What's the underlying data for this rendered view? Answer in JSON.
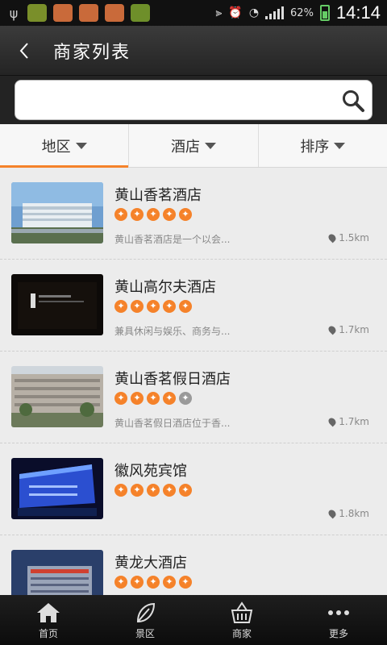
{
  "status_bar": {
    "battery": "62%",
    "time": "14:14"
  },
  "header": {
    "back_icon": "chevron-left-icon",
    "title": "商家列表"
  },
  "search": {
    "value": "",
    "placeholder": ""
  },
  "filters": [
    {
      "label": "地区",
      "active": true
    },
    {
      "label": "酒店",
      "active": false
    },
    {
      "label": "排序",
      "active": false
    }
  ],
  "list": [
    {
      "name": "黄山香茗酒店",
      "rating": 5,
      "desc": "黄山香茗酒店是一个以会...",
      "distance": "1.5km"
    },
    {
      "name": "黄山高尔夫酒店",
      "rating": 5,
      "desc": "兼具休闲与娱乐、商务与...",
      "distance": "1.7km"
    },
    {
      "name": "黄山香茗假日酒店",
      "rating": 4,
      "desc": "黄山香茗假日酒店位于香...",
      "distance": "1.7km"
    },
    {
      "name": "徽风苑宾馆",
      "rating": 5,
      "desc": "",
      "distance": "1.8km"
    },
    {
      "name": "黄龙大酒店",
      "rating": 5,
      "desc": "",
      "distance": ""
    }
  ],
  "bottom_nav": [
    {
      "label": "首页",
      "icon": "home-icon"
    },
    {
      "label": "景区",
      "icon": "leaf-icon"
    },
    {
      "label": "商家",
      "icon": "basket-icon"
    },
    {
      "label": "更多",
      "icon": "more-icon"
    }
  ],
  "colors": {
    "accent": "#f5822a",
    "header_bg": "#2e2e2e",
    "list_bg": "#ececec"
  }
}
